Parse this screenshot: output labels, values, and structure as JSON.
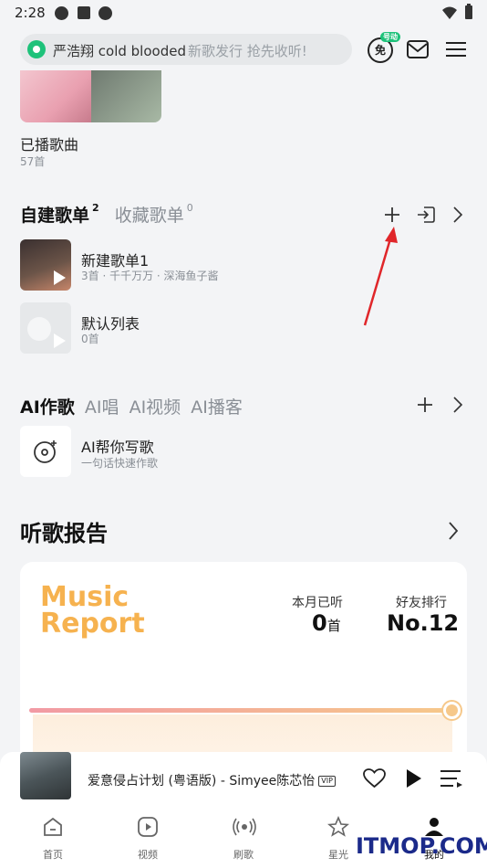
{
  "status_bar": {
    "time": "2:28"
  },
  "search": {
    "query": "严浩翔 cold blooded",
    "hint": "新歌发行 抢先收听!"
  },
  "header": {
    "vip_label": "免",
    "vip_tag": "号动"
  },
  "played": {
    "title": "已播歌曲",
    "count": "57首"
  },
  "playlists": {
    "tab_created": "自建歌单",
    "created_count": "2",
    "tab_collected": "收藏歌单",
    "collected_count": "0",
    "items": [
      {
        "name": "新建歌单1",
        "sub": "3首 · 千千万万 · 深海鱼子酱"
      },
      {
        "name": "默认列表",
        "sub": "0首"
      }
    ]
  },
  "ai": {
    "tabs": [
      "AI作歌",
      "AI唱",
      "AI视频",
      "AI播客"
    ],
    "item": {
      "name": "AI帮你写歌",
      "sub": "一句话快速作歌"
    }
  },
  "report": {
    "title": "听歌报告",
    "logo_line1": "Music",
    "logo_line2": "Report",
    "listened_label": "本月已听",
    "listened_value": "0",
    "listened_unit": "首",
    "rank_label": "好友排行",
    "rank_value": "No.12",
    "progress": 1.0
  },
  "mini_player": {
    "title": "爱意侵占计划 (粤语版) - Simyee陈芯怡",
    "vip": "VIP"
  },
  "tabs": [
    {
      "label": "首页",
      "icon": "home-icon"
    },
    {
      "label": "视频",
      "icon": "video-icon"
    },
    {
      "label": "刷歌",
      "icon": "radio-icon"
    },
    {
      "label": "星光",
      "icon": "star-icon"
    },
    {
      "label": "我的",
      "icon": "profile-icon"
    }
  ],
  "watermark": "ITMOP.COM",
  "colors": {
    "accent_green": "#1ec27a",
    "report_orange": "#f6b24f",
    "annotation_red": "#e0262a"
  }
}
